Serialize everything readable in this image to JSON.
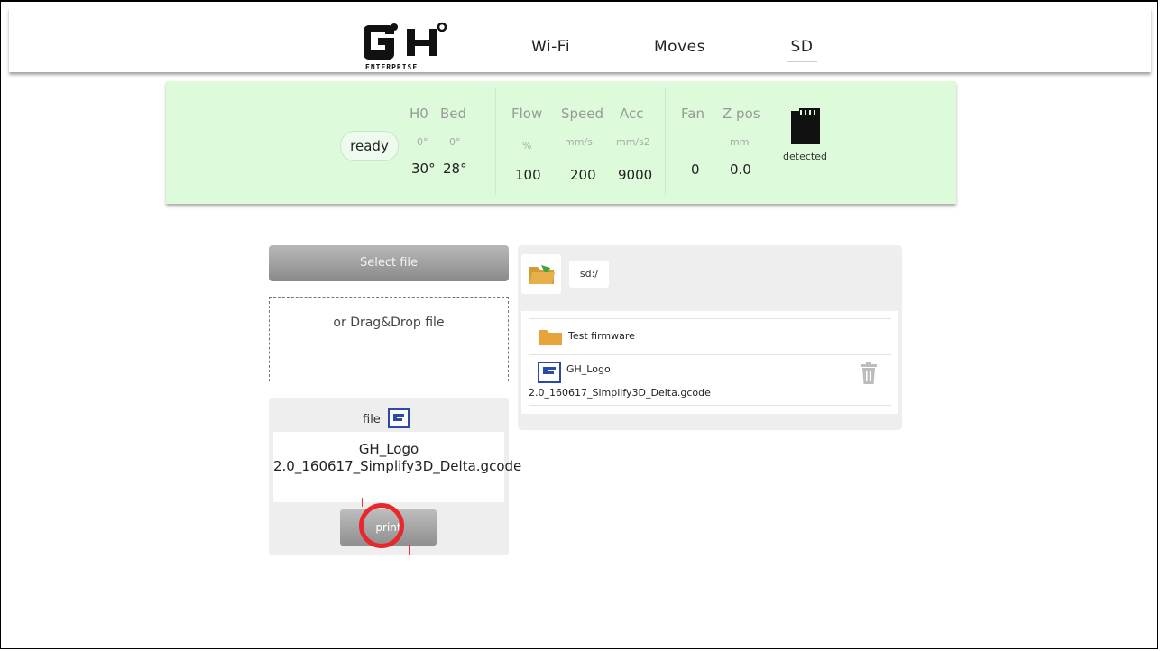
{
  "header": {
    "logo_text": "GH",
    "logo_subtext": "ENTERPRISE",
    "nav": [
      "Wi-Fi",
      "Moves",
      "SD"
    ]
  },
  "status": {
    "state": "ready",
    "temps": {
      "h0_label": "H0",
      "bed_label": "Bed",
      "h0_target": "0°",
      "bed_target": "0°",
      "h0_value": "30°",
      "bed_value": "28°"
    },
    "motion": {
      "flow_label": "Flow",
      "speed_label": "Speed",
      "acc_label": "Acc",
      "flow_unit": "%",
      "speed_unit": "mm/s",
      "acc_unit": "mm/s2",
      "flow_value": "100",
      "speed_value": "200",
      "acc_value": "9000"
    },
    "misc": {
      "fan_label": "Fan",
      "zpos_label": "Z pos",
      "zpos_unit": "mm",
      "fan_value": "0",
      "zpos_value": "0.0"
    },
    "sd": {
      "label": "detected"
    }
  },
  "upload": {
    "select_label": "Select file",
    "drop_label": "or Drag&Drop file",
    "file_label": "file",
    "filename": "GH_Logo 2.0_160617_Simplify3D_Delta.gcode",
    "print_label": "print"
  },
  "browser": {
    "path": "sd:/",
    "items": [
      {
        "type": "folder",
        "name": "Test firmware"
      },
      {
        "type": "file",
        "name_line1": "GH_Logo",
        "name_line2": "2.0_160617_Simplify3D_Delta.gcode"
      }
    ]
  },
  "colors": {
    "status_bg": "#ddfadb",
    "highlight": "#e8262b",
    "folder": "#e8a43a",
    "file_icon": "#2a4aa8"
  },
  "icons": [
    "folder-open-icon",
    "folder-icon",
    "gcode-file-icon",
    "trash-icon",
    "sd-card-icon"
  ]
}
